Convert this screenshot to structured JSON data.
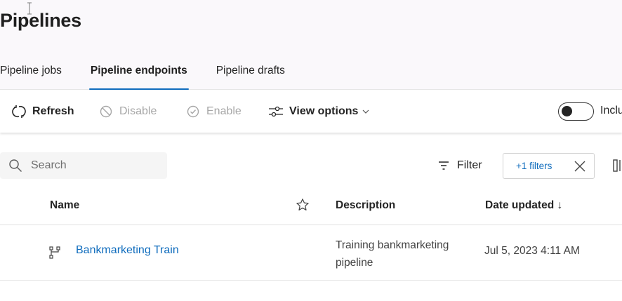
{
  "page": {
    "title": "Pipelines"
  },
  "tabs": [
    {
      "label": "Pipeline jobs"
    },
    {
      "label": "Pipeline endpoints"
    },
    {
      "label": "Pipeline drafts"
    }
  ],
  "toolbar": {
    "refresh": "Refresh",
    "disable": "Disable",
    "enable": "Enable",
    "view_options": "View options",
    "toggle_label": "Inclu"
  },
  "search": {
    "placeholder": "Search"
  },
  "filter": {
    "label": "Filter",
    "chip": "+1 filters"
  },
  "table": {
    "headers": {
      "name": "Name",
      "description": "Description",
      "date_updated": "Date updated ↓"
    },
    "rows": [
      {
        "name": "Bankmarketing Train",
        "description": "Training bankmarketing pipeline",
        "date_updated": "Jul 5, 2023 4:11 AM"
      }
    ]
  },
  "colors": {
    "accent": "#0f6cbd",
    "header_bg": "#faf8fb",
    "disabled_text": "#a6a6a6"
  },
  "icons": [
    "refresh-icon",
    "disable-icon",
    "enable-icon",
    "view-options-icon",
    "search-icon",
    "filter-icon",
    "close-icon",
    "columns-icon",
    "star-icon",
    "pipeline-icon"
  ]
}
